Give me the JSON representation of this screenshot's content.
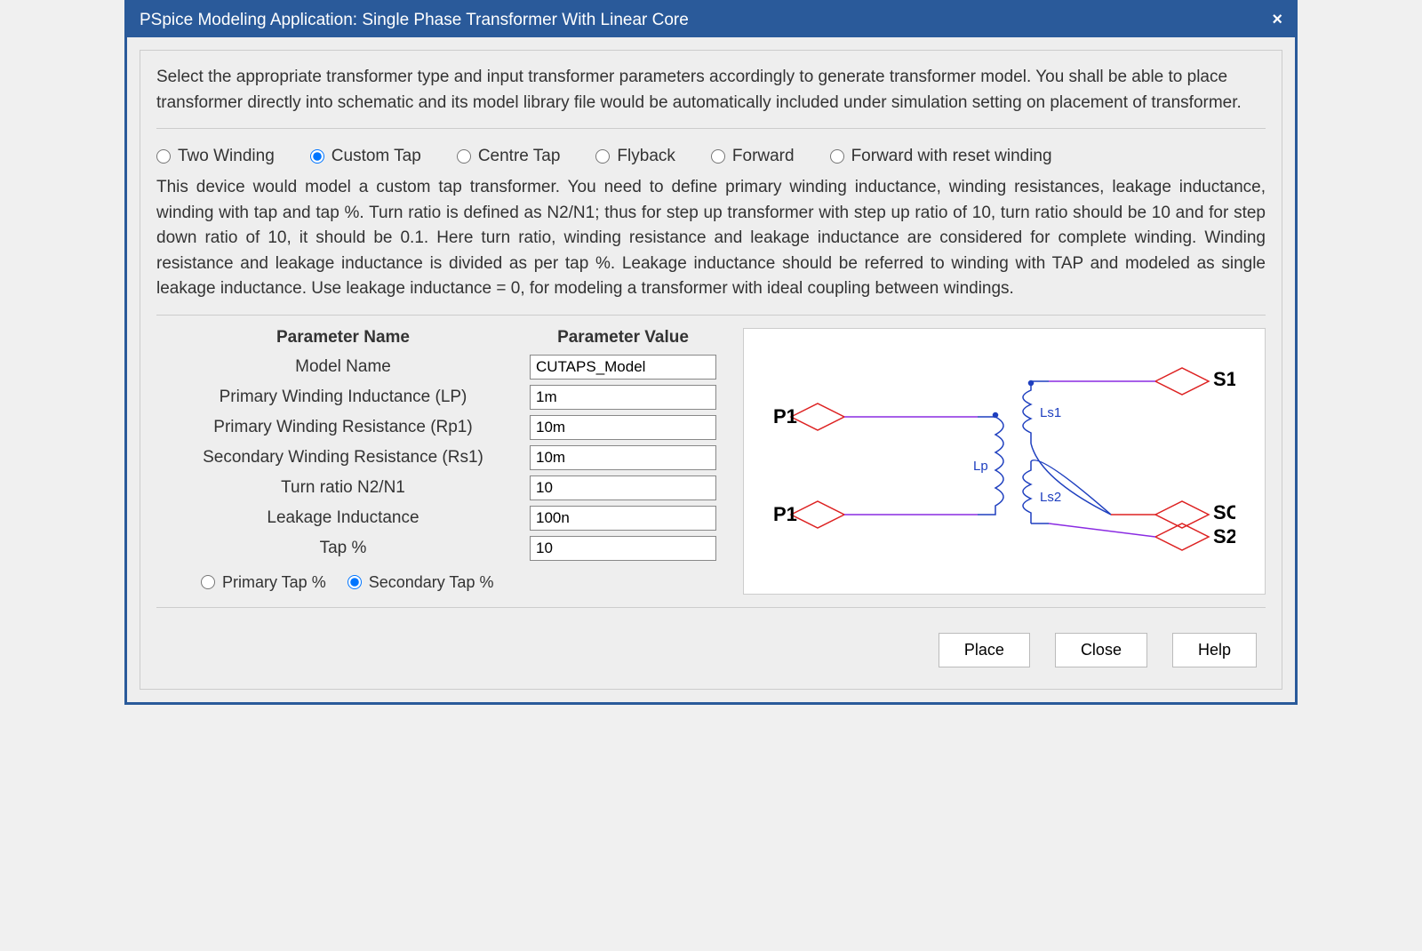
{
  "title": "PSpice Modeling Application: Single Phase Transformer With Linear Core",
  "intro": "Select the appropriate transformer type and input transformer parameters accordingly to generate transformer model. You shall be able to place transformer directly into schematic and its model library file would be automatically included under simulation setting on placement of transformer.",
  "types": {
    "two_winding": "Two Winding",
    "custom_tap": "Custom Tap",
    "centre_tap": "Centre Tap",
    "flyback": "Flyback",
    "forward": "Forward",
    "forward_reset": "Forward with reset winding",
    "selected": "custom_tap"
  },
  "device_desc": "This device would model a custom tap transformer. You need to define primary winding inductance, winding resistances, leakage inductance, winding with tap and tap %. Turn ratio is defined as N2/N1; thus for step up transformer with step up ratio of 10, turn ratio should be 10 and for step down ratio of 10, it should be 0.1. Here turn ratio, winding resistance and leakage inductance are considered for complete winding. Winding resistance and leakage inductance is divided as per tap %. Leakage inductance should be referred to winding with TAP and modeled as single leakage inductance. Use leakage inductance = 0, for modeling a transformer with ideal coupling between windings.",
  "headers": {
    "name": "Parameter Name",
    "value": "Parameter Value"
  },
  "params": {
    "model_name": {
      "label": "Model Name",
      "value": "CUTAPS_Model"
    },
    "lp": {
      "label": "Primary Winding Inductance (LP)",
      "value": "1m"
    },
    "rp1": {
      "label": "Primary Winding Resistance (Rp1)",
      "value": "10m"
    },
    "rs1": {
      "label": "Secondary Winding Resistance (Rs1)",
      "value": "10m"
    },
    "ratio": {
      "label": "Turn ratio N2/N1",
      "value": "10"
    },
    "leakage": {
      "label": "Leakage Inductance",
      "value": "100n"
    },
    "tap_pct": {
      "label": "Tap %",
      "value": "10"
    }
  },
  "tap_side": {
    "primary": "Primary Tap %",
    "secondary": "Secondary Tap %",
    "selected": "secondary"
  },
  "schematic": {
    "pins": {
      "p1_top": "P1",
      "p1_bot": "P1",
      "s1": "S1",
      "sc": "SC",
      "s2": "S2"
    },
    "labels": {
      "lp": "Lp",
      "ls1": "Ls1",
      "ls2": "Ls2"
    }
  },
  "buttons": {
    "place": "Place",
    "close": "Close",
    "help": "Help"
  }
}
